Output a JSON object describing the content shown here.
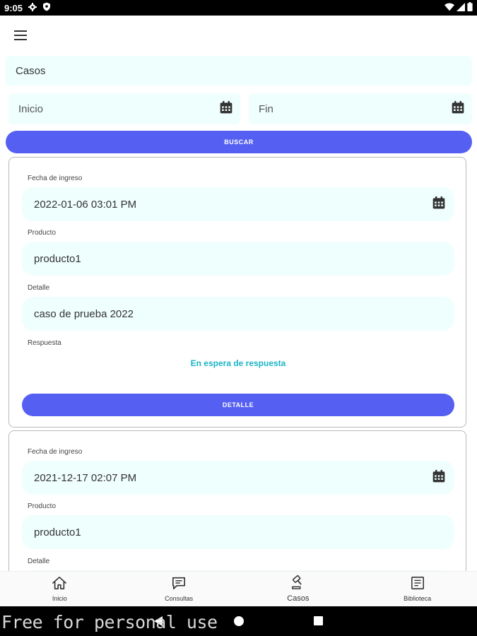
{
  "status_bar": {
    "time": "9:05",
    "left_icons": [
      "gear-icon",
      "shield-icon"
    ],
    "right_icons": [
      "wifi-icon",
      "signal-icon",
      "battery-icon"
    ]
  },
  "app_bar": {
    "menu_icon": "hamburger-menu-icon"
  },
  "filters": {
    "category_value": "Casos",
    "start_placeholder": "Inicio",
    "end_placeholder": "Fin",
    "search_label": "BUSCAR"
  },
  "cases": [
    {
      "date_label": "Fecha de ingreso",
      "date_value": "2022-01-06 03:01 PM",
      "product_label": "Producto",
      "product_value": "producto1",
      "detail_label": "Detalle",
      "detail_value": "caso de prueba 2022",
      "response_label": "Respuesta",
      "response_value": "En espera de respuesta",
      "detail_button": "DETALLE"
    },
    {
      "date_label": "Fecha de ingreso",
      "date_value": "2021-12-17 02:07 PM",
      "product_label": "Producto",
      "product_value": "producto1",
      "detail_label": "Detalle"
    }
  ],
  "bottom_nav": [
    {
      "label": "Inicio",
      "icon": "home-icon"
    },
    {
      "label": "Consultas",
      "icon": "chat-icon"
    },
    {
      "label": "Casos",
      "icon": "gavel-icon",
      "active": true
    },
    {
      "label": "Biblioteca",
      "icon": "library-icon"
    }
  ],
  "watermark": "Free for personal use",
  "colors": {
    "accent": "#5560f2",
    "field_bg": "#effffd",
    "pending_text": "#1ab3c4"
  }
}
